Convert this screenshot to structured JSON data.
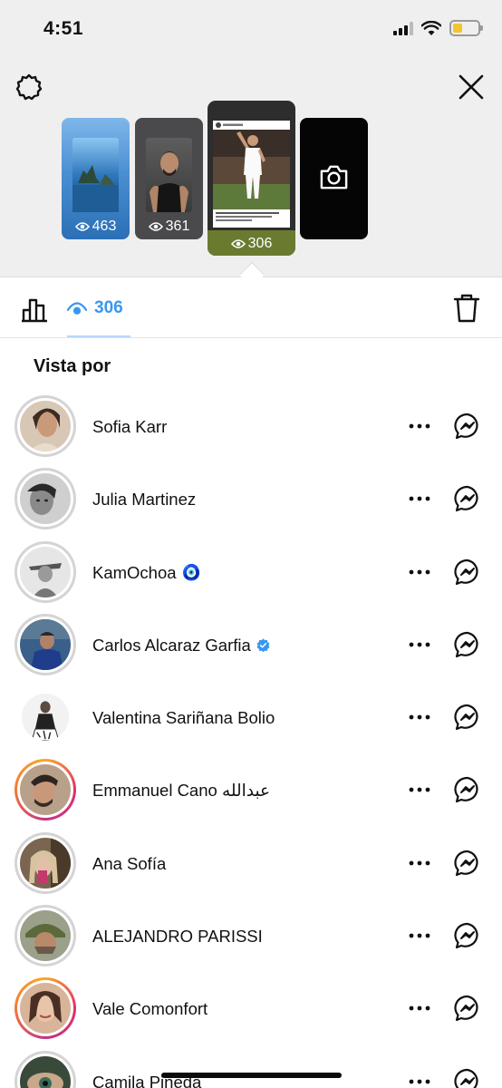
{
  "status": {
    "time": "4:51"
  },
  "stories": [
    {
      "views": "463"
    },
    {
      "views": "361"
    },
    {
      "views": "306"
    },
    {
      "type": "camera"
    }
  ],
  "tabs": {
    "views_count": "306"
  },
  "section_title": "Vista por",
  "viewers": [
    {
      "name": "Sofia Karr",
      "badge": "",
      "ring": "seen"
    },
    {
      "name": "Julia Martinez",
      "badge": "",
      "ring": "seen"
    },
    {
      "name": "KamOchoa",
      "badge": "🧿",
      "ring": "seen"
    },
    {
      "name": "Carlos Alcaraz Garfia",
      "badge": "verified",
      "ring": "seen"
    },
    {
      "name": "Valentina Sariñana Bolio",
      "badge": "",
      "ring": "none"
    },
    {
      "name": "Emmanuel Cano عبدالله",
      "badge": "",
      "ring": "story"
    },
    {
      "name": "Ana Sofía",
      "badge": "",
      "ring": "seen"
    },
    {
      "name": "ALEJANDRO PARISSI",
      "badge": "",
      "ring": "seen"
    },
    {
      "name": "Vale Comonfort",
      "badge": "",
      "ring": "story"
    },
    {
      "name": "Camila Pineda",
      "badge": "",
      "ring": "seen"
    }
  ],
  "colors": {
    "accent": "#3897f0",
    "verified": "#3897f0"
  }
}
